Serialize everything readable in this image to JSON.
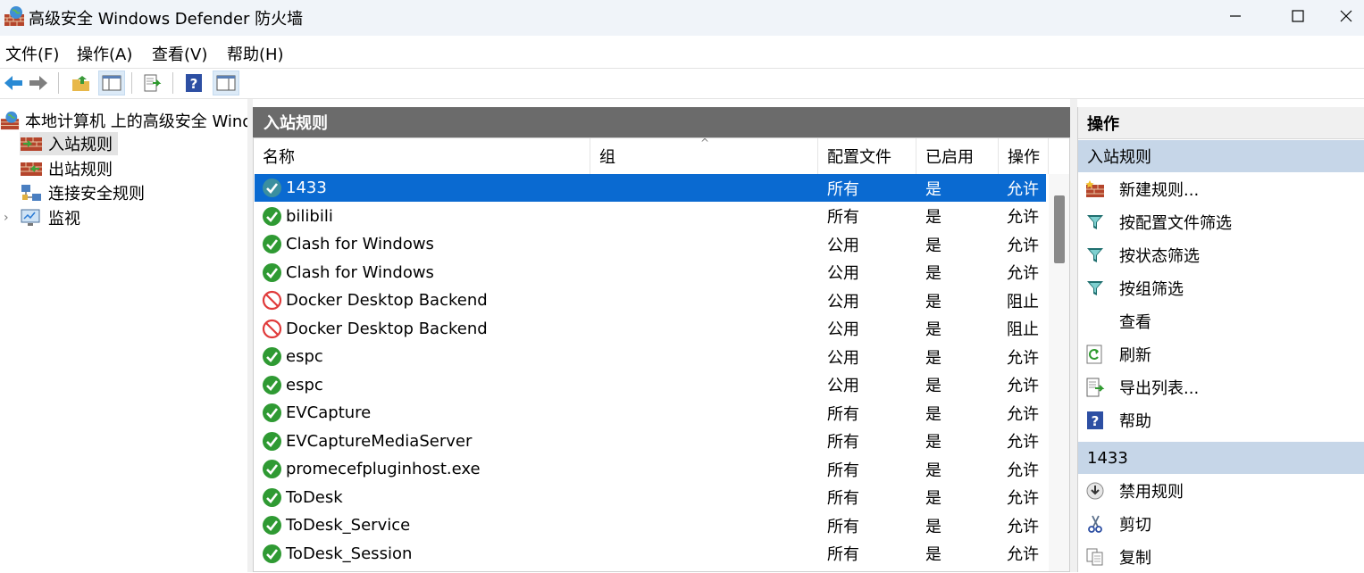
{
  "window": {
    "title": "高级安全 Windows Defender 防火墙",
    "app_icon": "firewall-globe-icon",
    "controls": [
      "minimize-icon",
      "maximize-icon",
      "close-icon"
    ]
  },
  "menu": [
    "文件(F)",
    "操作(A)",
    "查看(V)",
    "帮助(H)"
  ],
  "toolbar": [
    "back-arrow-icon",
    "forward-arrow-icon",
    "up-folder-icon",
    "show-hide-console-tree-icon",
    "export-list-icon",
    "help-icon",
    "show-hide-action-pane-icon"
  ],
  "tree": {
    "root": "本地计算机 上的高级安全 Windows Defender 防火墙",
    "items": [
      {
        "label": "入站规则",
        "icon": "inbound-rules-icon",
        "selected": true
      },
      {
        "label": "出站规则",
        "icon": "outbound-rules-icon",
        "selected": false
      },
      {
        "label": "连接安全规则",
        "icon": "connection-security-icon",
        "selected": false
      },
      {
        "label": "监视",
        "icon": "monitoring-icon",
        "selected": false,
        "expandable": true
      }
    ]
  },
  "center": {
    "title": "入站规则",
    "columns": [
      "名称",
      "组",
      "配置文件",
      "已启用",
      "操作"
    ],
    "sort_indicator": "^",
    "rows": [
      {
        "name": "1433",
        "group": "",
        "profile": "所有",
        "enabled": "是",
        "action": "允许",
        "status": "allow",
        "selected": true
      },
      {
        "name": "bilibili",
        "group": "",
        "profile": "所有",
        "enabled": "是",
        "action": "允许",
        "status": "allow"
      },
      {
        "name": "Clash for Windows",
        "group": "",
        "profile": "公用",
        "enabled": "是",
        "action": "允许",
        "status": "allow"
      },
      {
        "name": "Clash for Windows",
        "group": "",
        "profile": "公用",
        "enabled": "是",
        "action": "允许",
        "status": "allow"
      },
      {
        "name": "Docker Desktop Backend",
        "group": "",
        "profile": "公用",
        "enabled": "是",
        "action": "阻止",
        "status": "block"
      },
      {
        "name": "Docker Desktop Backend",
        "group": "",
        "profile": "公用",
        "enabled": "是",
        "action": "阻止",
        "status": "block"
      },
      {
        "name": "espc",
        "group": "",
        "profile": "公用",
        "enabled": "是",
        "action": "允许",
        "status": "allow"
      },
      {
        "name": "espc",
        "group": "",
        "profile": "公用",
        "enabled": "是",
        "action": "允许",
        "status": "allow"
      },
      {
        "name": "EVCapture",
        "group": "",
        "profile": "所有",
        "enabled": "是",
        "action": "允许",
        "status": "allow"
      },
      {
        "name": "EVCaptureMediaServer",
        "group": "",
        "profile": "所有",
        "enabled": "是",
        "action": "允许",
        "status": "allow"
      },
      {
        "name": "promecefpluginhost.exe",
        "group": "",
        "profile": "所有",
        "enabled": "是",
        "action": "允许",
        "status": "allow"
      },
      {
        "name": "ToDesk",
        "group": "",
        "profile": "所有",
        "enabled": "是",
        "action": "允许",
        "status": "allow"
      },
      {
        "name": "ToDesk_Service",
        "group": "",
        "profile": "所有",
        "enabled": "是",
        "action": "允许",
        "status": "allow"
      },
      {
        "name": "ToDesk_Session",
        "group": "",
        "profile": "所有",
        "enabled": "是",
        "action": "允许",
        "status": "allow"
      }
    ]
  },
  "actions": {
    "title": "操作",
    "sections": [
      {
        "header": "入站规则",
        "items": [
          {
            "label": "新建规则...",
            "icon": "new-rule-icon"
          },
          {
            "label": "按配置文件筛选",
            "icon": "filter-icon"
          },
          {
            "label": "按状态筛选",
            "icon": "filter-icon"
          },
          {
            "label": "按组筛选",
            "icon": "filter-icon"
          },
          {
            "label": "查看",
            "icon": ""
          },
          {
            "label": "刷新",
            "icon": "refresh-icon"
          },
          {
            "label": "导出列表...",
            "icon": "export-list-icon"
          },
          {
            "label": "帮助",
            "icon": "help-icon"
          }
        ]
      },
      {
        "header": "1433",
        "items": [
          {
            "label": "禁用规则",
            "icon": "disable-rule-icon"
          },
          {
            "label": "剪切",
            "icon": "cut-icon"
          },
          {
            "label": "复制",
            "icon": "copy-icon"
          }
        ]
      }
    ]
  }
}
